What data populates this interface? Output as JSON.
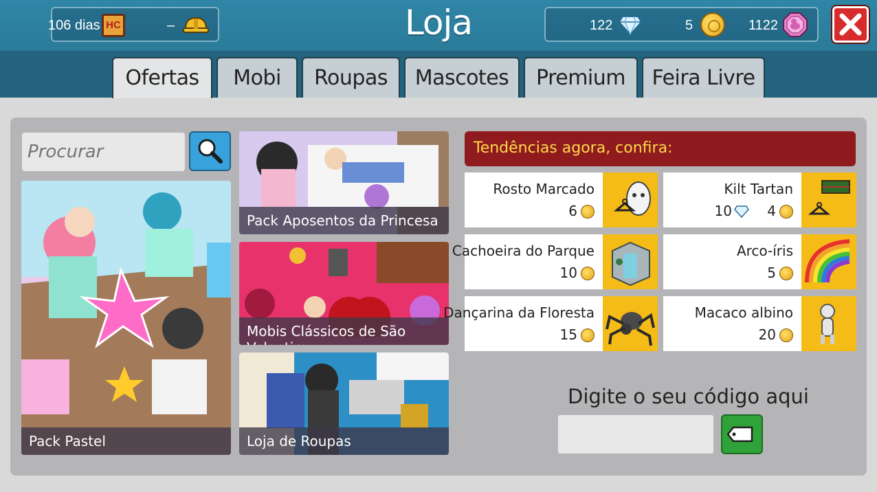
{
  "header": {
    "title": "Loja",
    "days_text": "106 dias",
    "hc_badge": "HC",
    "builder_text": "–",
    "diamonds": "122",
    "coins": "5",
    "duckets": "1122",
    "icons": [
      "hc-icon",
      "builders-helmet-icon",
      "diamond-icon",
      "coin-icon",
      "ducket-icon",
      "close-icon"
    ]
  },
  "tabs": [
    {
      "label": "Ofertas",
      "active": true
    },
    {
      "label": "Mobi",
      "active": false
    },
    {
      "label": "Roupas",
      "active": false
    },
    {
      "label": "Mascotes",
      "active": false
    },
    {
      "label": "Premium",
      "active": false
    },
    {
      "label": "Feira Livre",
      "active": false
    }
  ],
  "search": {
    "placeholder": "Procurar"
  },
  "offers": [
    {
      "label": "Pack Pastel"
    },
    {
      "label": "Pack Aposentos da Princesa"
    },
    {
      "label": "Mobis Clássicos de São Valentim"
    },
    {
      "label": "Loja de Roupas"
    }
  ],
  "trending": {
    "title": "Tendências agora, confira:",
    "items": [
      {
        "name": "Rosto Marcado",
        "price": "6",
        "diamonds": null
      },
      {
        "name": "Kilt Tartan",
        "price": "4",
        "diamonds": "10"
      },
      {
        "name": "Cachoeira do Parque",
        "price": "10",
        "diamonds": null
      },
      {
        "name": "Arco-íris",
        "price": "5",
        "diamonds": null
      },
      {
        "name": "Dançarina da Floresta",
        "price": "15",
        "diamonds": null
      },
      {
        "name": "Macaco albino",
        "price": "20",
        "diamonds": null
      }
    ]
  },
  "code": {
    "label": "Digite o seu código aqui",
    "value": ""
  },
  "colors": {
    "header": "#2f86a6",
    "trend_bar": "#8f1b1e",
    "trend_text": "#fdd94a",
    "item_bg": "#f5bc17",
    "close_red": "#d82b2b",
    "search_blue": "#38a2dd",
    "code_green": "#2fa33a"
  }
}
